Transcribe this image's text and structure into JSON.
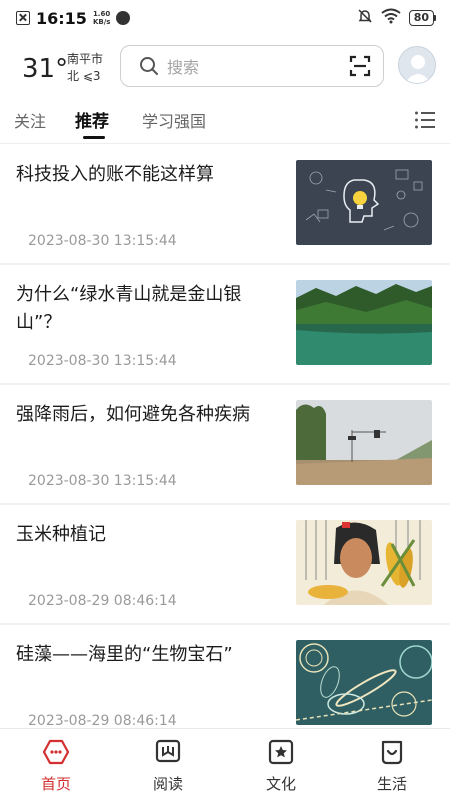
{
  "status_bar": {
    "time": "16:15",
    "net_speed_value": "1.60",
    "net_speed_unit": "KB/s",
    "battery": "80"
  },
  "header": {
    "temperature": "31°",
    "city": "南平市",
    "wind": "北 ⩽3",
    "search_placeholder": "搜索"
  },
  "tabs": [
    {
      "label": "关注"
    },
    {
      "label": "推荐",
      "active": true
    },
    {
      "label": "学习强国"
    }
  ],
  "articles": [
    {
      "title": "科技投入的账不能这样算",
      "time": "2023-08-30 13:15:44",
      "thumb": "brain-lightbulb-illustration"
    },
    {
      "title": "为什么“绿水青山就是金山银山”？",
      "time": "2023-08-30 13:15:44",
      "thumb": "green-lake-mountains"
    },
    {
      "title": "强降雨后，如何避免各种疾病",
      "time": "2023-08-30 13:15:44",
      "thumb": "flooded-street"
    },
    {
      "title": "玉米种植记",
      "time": "2023-08-29 08:46:14",
      "thumb": "corn-harvest-illustration"
    },
    {
      "title": "硅藻——海里的“生物宝石”",
      "time": "2023-08-29 08:46:14",
      "thumb": "diatom-microscope"
    }
  ],
  "bottom_nav": [
    {
      "label": "首页",
      "icon": "home-icon",
      "active": true
    },
    {
      "label": "阅读",
      "icon": "book-icon"
    },
    {
      "label": "文化",
      "icon": "star-frame-icon"
    },
    {
      "label": "生活",
      "icon": "smile-bag-icon"
    }
  ],
  "colors": {
    "accent": "#d32f2f",
    "text_primary": "#1c1c1c",
    "text_secondary": "#9a9a9a"
  }
}
